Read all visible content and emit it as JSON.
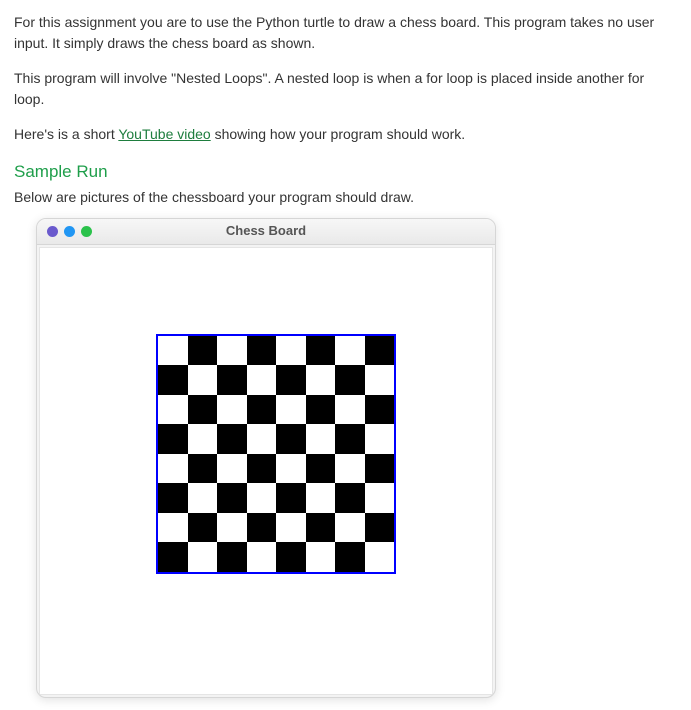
{
  "paragraphs": {
    "intro": "For this assignment you are to use the Python turtle to draw a chess board. This program takes no user input. It simply draws the chess board as shown.",
    "nested": "This program will involve \"Nested Loops\". A nested loop is when a for loop is placed inside another for loop.",
    "link_prefix": "Here's is a short ",
    "link_text": "YouTube video",
    "link_suffix": " showing how your program should work."
  },
  "heading": "Sample Run",
  "subtext": "Below are pictures of the chessboard your program should draw.",
  "window": {
    "title": "Chess Board"
  },
  "chessboard": {
    "rows": 8,
    "cols": 8,
    "border_color": "#0000ff",
    "colors": [
      "#ffffff",
      "#000000"
    ]
  }
}
